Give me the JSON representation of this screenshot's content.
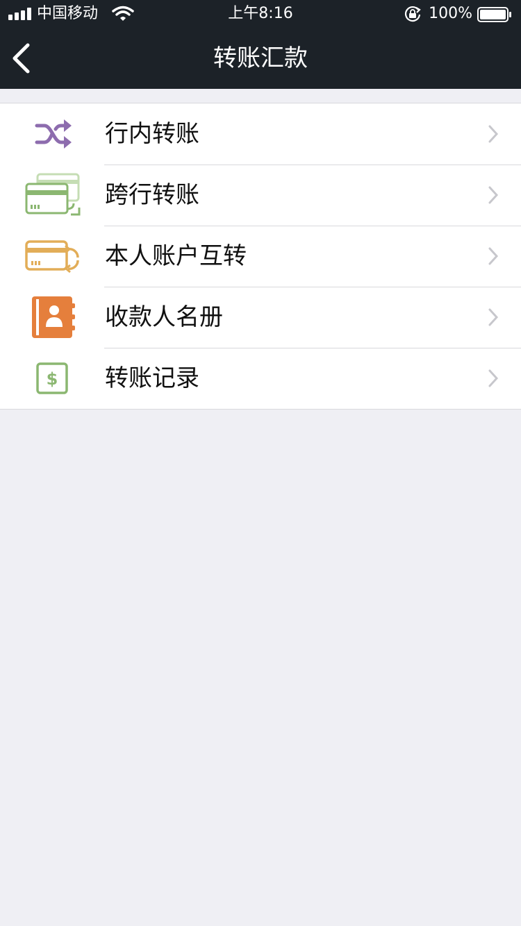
{
  "status_bar": {
    "carrier": "中国移动",
    "time": "上午8:16",
    "battery": "100%"
  },
  "nav": {
    "title": "转账汇款"
  },
  "menu": [
    {
      "label": "行内转账",
      "icon": "shuffle-icon",
      "color": "#8d6cae"
    },
    {
      "label": "跨行转账",
      "icon": "cards-transfer-icon",
      "color": "#8bb771"
    },
    {
      "label": "本人账户互转",
      "icon": "card-refresh-icon",
      "color": "#e2ad58"
    },
    {
      "label": "收款人名册",
      "icon": "contact-book-icon",
      "color": "#e57f3c"
    },
    {
      "label": "转账记录",
      "icon": "dollar-record-icon",
      "color": "#8bb771"
    }
  ],
  "colors": {
    "nav_background": "#1c2228",
    "page_background": "#efeff4",
    "chevron": "#c7c7cc"
  }
}
